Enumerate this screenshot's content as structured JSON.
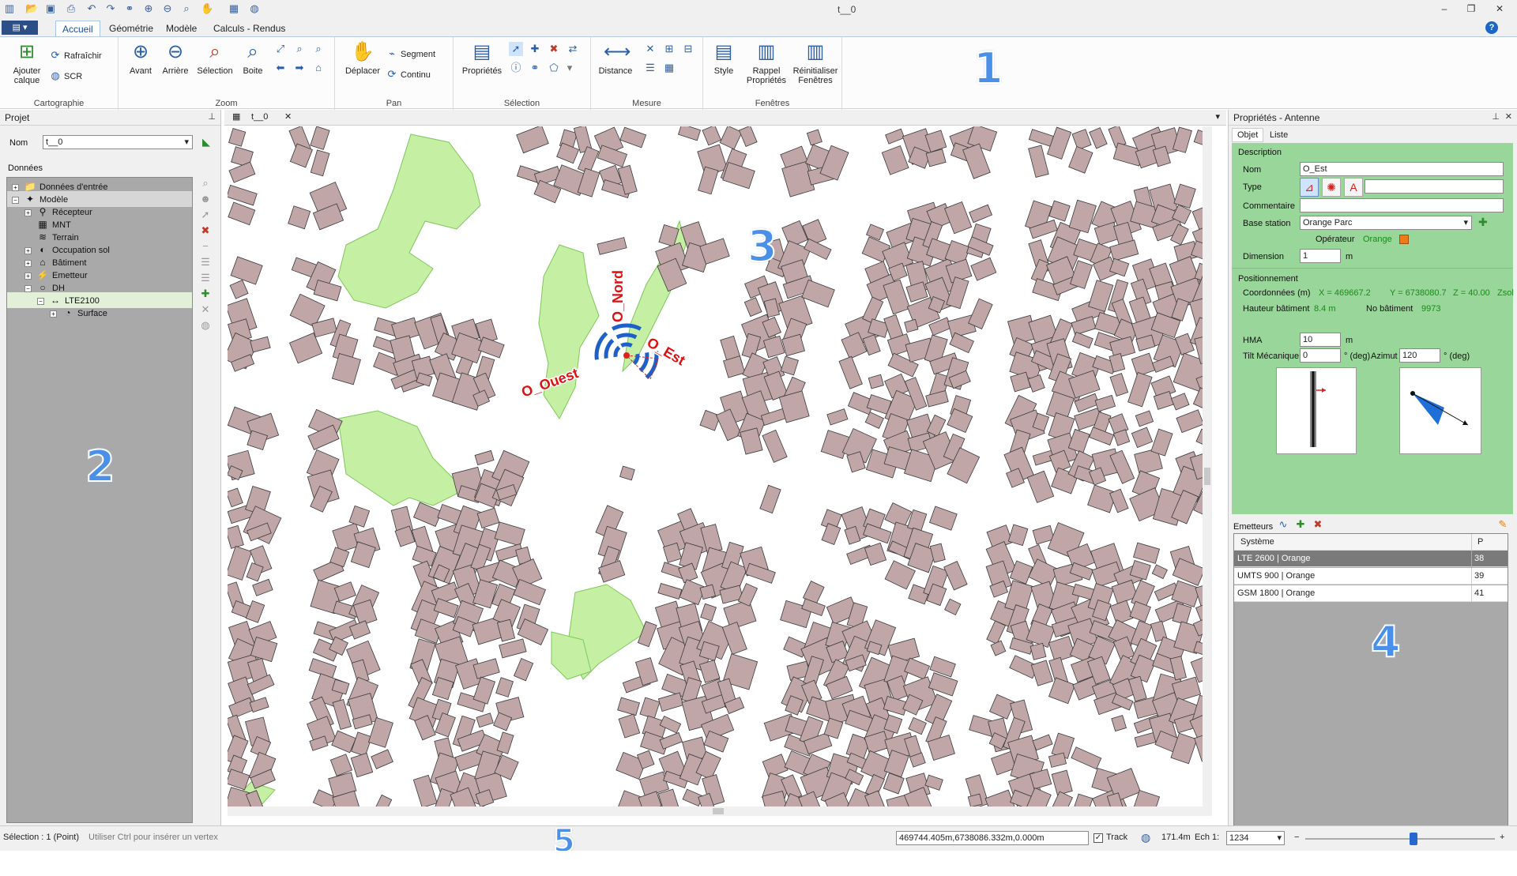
{
  "window": {
    "title": "t__0",
    "minimize": "–",
    "restore": "❐",
    "close": "✕"
  },
  "ribbon": {
    "file_button": "▤ ▾",
    "tabs": [
      "Accueil",
      "Géométrie",
      "Modèle",
      "Calculs - Rendus"
    ],
    "active_tab": "Accueil",
    "groups": {
      "cartographie": {
        "label": "Cartographie",
        "add_layer": "Ajouter\ncalque",
        "refresh": "Rafraîchir",
        "scr": "SCR"
      },
      "zoom": {
        "label": "Zoom",
        "forward": "Avant",
        "back": "Arrière",
        "selection": "Sélection",
        "box": "Boite"
      },
      "pan": {
        "label": "Pan",
        "move": "Déplacer",
        "segment": "Segment",
        "continuous": "Continu"
      },
      "selection": {
        "label": "Sélection",
        "properties": "Propriétés"
      },
      "measure": {
        "label": "Mesure",
        "distance": "Distance"
      },
      "windows": {
        "label": "Fenêtres",
        "style": "Style",
        "recall": "Rappel\nPropriétés",
        "reset": "Réinitialiser\nFenêtres"
      }
    }
  },
  "annotations": [
    "1",
    "2",
    "3",
    "4",
    "5"
  ],
  "project_panel": {
    "title": "Projet",
    "name_label": "Nom",
    "name_value": "t__0",
    "data_label": "Données",
    "tree": [
      {
        "label": "Données d'entrée",
        "level": 0,
        "expander": "+",
        "icon": "📁"
      },
      {
        "label": "Modèle",
        "level": 0,
        "expander": "−",
        "icon": "✦"
      },
      {
        "label": "Récepteur",
        "level": 1,
        "expander": "+",
        "icon": "⚲"
      },
      {
        "label": "MNT",
        "level": 1,
        "expander": "",
        "icon": "▦"
      },
      {
        "label": "Terrain",
        "level": 1,
        "expander": "",
        "icon": "≋"
      },
      {
        "label": "Occupation sol",
        "level": 1,
        "expander": "+",
        "icon": "◐"
      },
      {
        "label": "Bâtiment",
        "level": 1,
        "expander": "+",
        "icon": "⌂"
      },
      {
        "label": "Emetteur",
        "level": 1,
        "expander": "+",
        "icon": "⚡"
      },
      {
        "label": "DH",
        "level": 1,
        "expander": "−",
        "icon": "○"
      },
      {
        "label": "LTE2100",
        "level": 2,
        "expander": "−",
        "icon": "↔"
      },
      {
        "label": "Surface",
        "level": 3,
        "expander": "+",
        "icon": "◔"
      }
    ]
  },
  "map": {
    "tab_label": "t__0",
    "antennas": [
      {
        "label": "O_Nord"
      },
      {
        "label": "O_Ouest"
      },
      {
        "label": "O_Est"
      }
    ]
  },
  "properties_panel": {
    "title": "Propriétés - Antenne",
    "tabs": [
      "Objet",
      "Liste"
    ],
    "description_label": "Description",
    "name_label": "Nom",
    "name_value": "O_Est",
    "type_label": "Type",
    "comment_label": "Commentaire",
    "base_station_label": "Base station",
    "base_station_value": "Orange Parc",
    "operator_label": "Opérateur",
    "operator_value": "Orange",
    "operator_color": "#f07a18",
    "dimension_label": "Dimension",
    "dimension_value": "1",
    "dimension_unit": "m",
    "positioning_label": "Positionnement",
    "coords_label": "Coordonnées (m)",
    "coords_x": "X = 469667.2",
    "coords_y": "Y = 6738080.7",
    "coords_z": "Z = 40.00",
    "coords_ref": "Zsol",
    "building_height_label": "Hauteur bâtiment",
    "building_height_value": "8.4 m",
    "building_no_label": "No bâtiment",
    "building_no_value": "9973",
    "hma_label": "HMA",
    "hma_value": "10",
    "hma_unit": "m",
    "tilt_label": "Tilt Mécanique",
    "tilt_value": "0",
    "tilt_unit": "° (deg)",
    "azimuth_label": "Azimut",
    "azimuth_value": "120",
    "azimuth_unit": "° (deg)",
    "emitters_label": "Emetteurs",
    "table_headers": [
      "Système",
      "P"
    ],
    "table_rows": [
      {
        "system": "LTE 2600 | Orange",
        "p": "38"
      },
      {
        "system": "UMTS 900 | Orange",
        "p": "39"
      },
      {
        "system": "GSM 1800 | Orange",
        "p": "41"
      }
    ]
  },
  "statusbar": {
    "selection": "Sélection : 1 (Point)",
    "hint": "Utiliser Ctrl pour insérer un vertex",
    "coordinates": "469744.405m,6738086.332m,0.000m",
    "track_label": "Track",
    "scale_distance": "171.4m",
    "scale_label": "Ech 1:",
    "scale_value": "1234",
    "zoom_minus": "−",
    "zoom_plus": "+"
  },
  "colors": {
    "building": "#c0a6a6",
    "building_edge": "#3a3a3a",
    "green": "#c5f0a4",
    "accent": "#2c5ea8",
    "antenna_blue": "#1f5fc8",
    "label_red": "#e01010"
  }
}
